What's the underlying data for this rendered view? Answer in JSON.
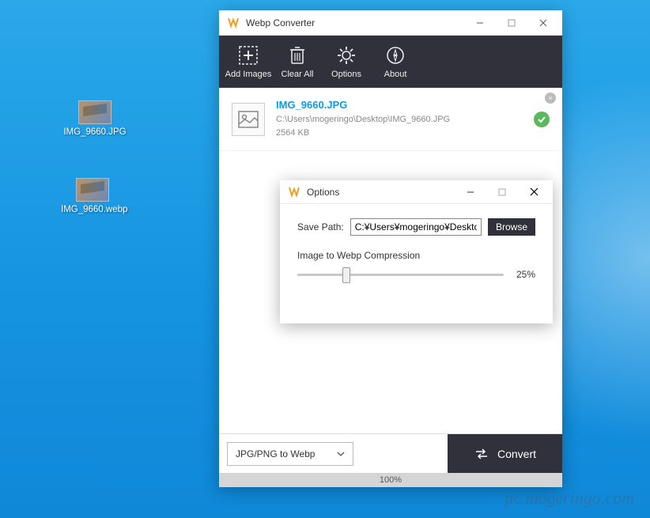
{
  "desktop": {
    "icons": [
      {
        "label": "IMG_9660.JPG"
      },
      {
        "label": "IMG_9660.webp"
      }
    ]
  },
  "app": {
    "title": "Webp Converter",
    "toolbar": {
      "add": "Add Images",
      "clear": "Clear All",
      "options": "Options",
      "about": "About"
    },
    "file": {
      "name": "IMG_9660.JPG",
      "path": "C:\\Users\\mogeringo\\Desktop\\IMG_9660.JPG",
      "size": "2564 KB"
    },
    "mode": "JPG/PNG to Webp",
    "convert": "Convert",
    "progress": "100%"
  },
  "options": {
    "title": "Options",
    "savePathLabel": "Save Path:",
    "savePathValue": "C:¥Users¥mogeringo¥Desktop¥",
    "browse": "Browse",
    "sliderLabel": "Image to Webp Compression",
    "sliderValue": "25%"
  },
  "watermark": "pc.mogeringo.com"
}
